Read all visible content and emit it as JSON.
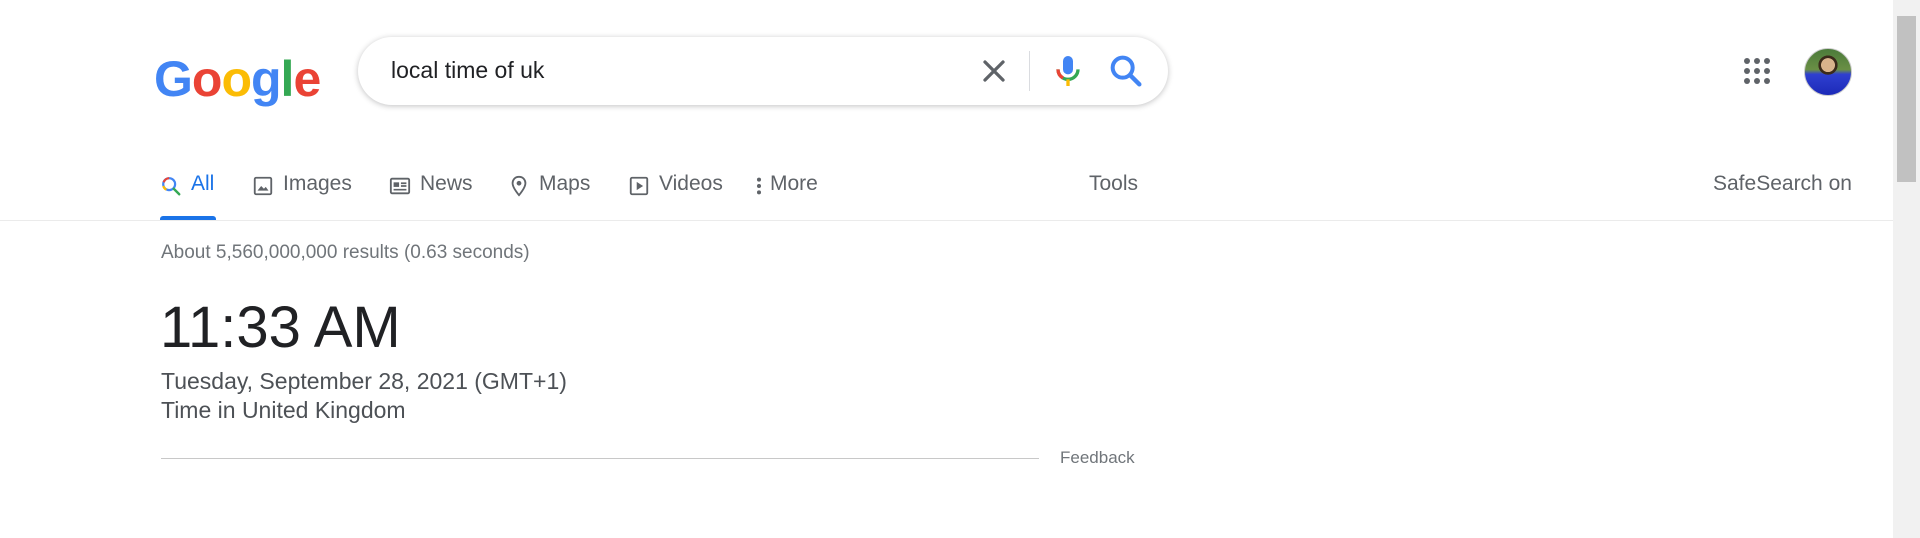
{
  "logo": {
    "letters": [
      "G",
      "o",
      "o",
      "g",
      "l",
      "e"
    ]
  },
  "search": {
    "query": "local time of uk"
  },
  "icons": {
    "clear": "close-icon",
    "mic": "microphone-icon",
    "search": "search-icon",
    "apps": "apps-grid-icon"
  },
  "tabs": [
    {
      "label": "All",
      "icon": "search-icon",
      "active": true
    },
    {
      "label": "Images",
      "icon": "image-icon",
      "active": false
    },
    {
      "label": "News",
      "icon": "news-icon",
      "active": false
    },
    {
      "label": "Maps",
      "icon": "map-pin-icon",
      "active": false
    },
    {
      "label": "Videos",
      "icon": "video-play-icon",
      "active": false
    },
    {
      "label": "More",
      "icon": "more-vertical-icon",
      "active": false
    }
  ],
  "tools_label": "Tools",
  "safesearch_label": "SafeSearch on",
  "results": {
    "stats": "About 5,560,000,000 results (0.63 seconds)",
    "time": "11:33 AM",
    "date": "Tuesday, September 28, 2021 (GMT+1)",
    "location": "Time in United Kingdom",
    "feedback": "Feedback"
  },
  "colors": {
    "accent": "#1a73e8",
    "google_blue": "#4285F4",
    "google_red": "#EA4335",
    "google_yellow": "#FBBC05",
    "google_green": "#34A853"
  }
}
